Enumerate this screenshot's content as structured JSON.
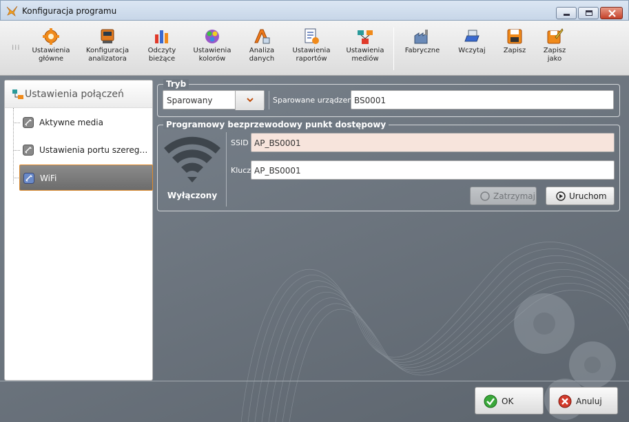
{
  "window": {
    "title": "Konfiguracja programu"
  },
  "toolbar": {
    "items": [
      {
        "label": "Ustawienia\ngłówne",
        "icon": "gear-icon"
      },
      {
        "label": "Konfiguracja\nanalizatora",
        "icon": "analyzer-icon"
      },
      {
        "label": "Odczyty\nbieżące",
        "icon": "bar-chart-icon"
      },
      {
        "label": "Ustawienia\nkolorów",
        "icon": "color-palette-icon"
      },
      {
        "label": "Analiza\ndanych",
        "icon": "data-analysis-icon"
      },
      {
        "label": "Ustawienia\nraportów",
        "icon": "report-icon"
      },
      {
        "label": "Ustawienia\nmediów",
        "icon": "network-media-icon"
      },
      {
        "label": "Fabryczne",
        "icon": "factory-icon"
      },
      {
        "label": "Wczytaj",
        "icon": "load-icon"
      },
      {
        "label": "Zapisz",
        "icon": "save-icon"
      },
      {
        "label": "Zapisz\njako",
        "icon": "save-as-icon"
      }
    ]
  },
  "sidebar": {
    "title": "Ustawienia połączeń",
    "items": [
      {
        "label": "Aktywne media"
      },
      {
        "label": "Ustawienia portu szeregowego"
      },
      {
        "label": "WiFi"
      }
    ]
  },
  "mode_group": {
    "title": "Tryb",
    "mode_value": "Sparowany",
    "paired_label": "Sparowane urządzenie",
    "paired_value": "BS0001"
  },
  "ap_group": {
    "title": "Programowy bezprzewodowy punkt dostępowy",
    "status": "Wyłączony",
    "ssid_label": "SSID",
    "ssid_value": "AP_BS0001",
    "key_label": "Klucz",
    "key_value": "AP_BS0001",
    "stop_label": "Zatrzymaj",
    "start_label": "Uruchom"
  },
  "footer": {
    "ok_label": "OK",
    "cancel_label": "Anuluj"
  },
  "colors": {
    "accent_orange": "#e08a2a",
    "background": "#6e7a86",
    "ok_green": "#3aa83a",
    "cancel_red": "#d23a2a"
  }
}
